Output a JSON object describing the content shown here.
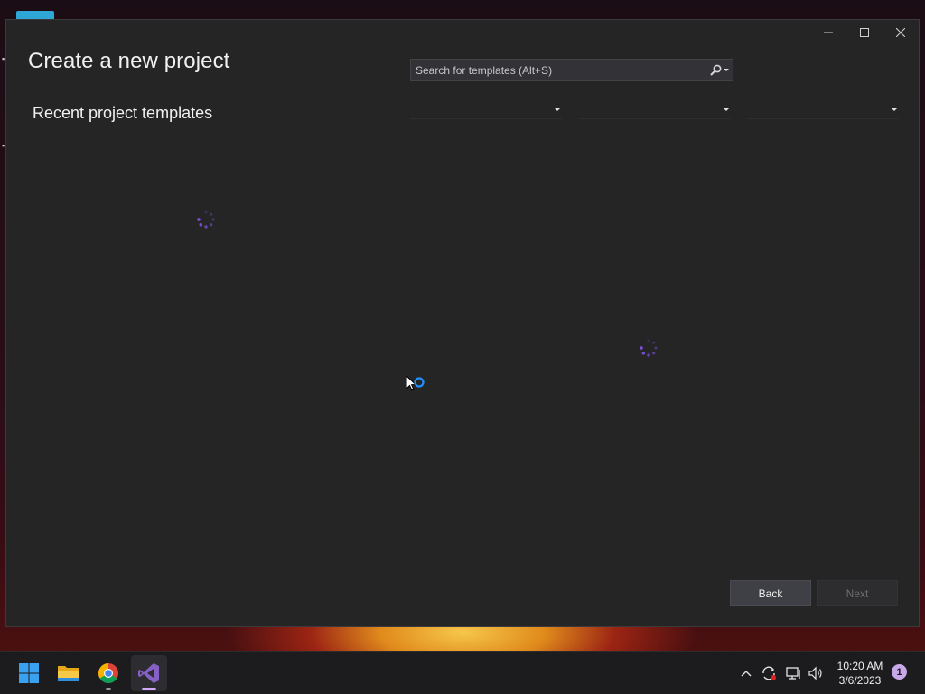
{
  "window": {
    "heading": "Create a new project",
    "recent_label": "Recent project templates",
    "controls": {
      "minimize": "minimize-icon",
      "maximize": "maximize-icon",
      "close": "close-icon"
    }
  },
  "search": {
    "placeholder": "Search for templates (Alt+S)",
    "value": ""
  },
  "filters": {
    "language": "",
    "platform": "",
    "project_type": ""
  },
  "buttons": {
    "back": "Back",
    "next": "Next"
  },
  "taskbar": {
    "apps": [
      "windows-start-icon",
      "file-explorer-icon",
      "chrome-icon",
      "visual-studio-icon"
    ],
    "active_app": "visual-studio-icon",
    "clock_time": "10:20 AM",
    "clock_date": "3/6/2023",
    "notification_count": "1"
  },
  "colors": {
    "window_bg": "#252526",
    "accent_purple": "#7b52d8",
    "busy_blue": "#1e90ff"
  }
}
